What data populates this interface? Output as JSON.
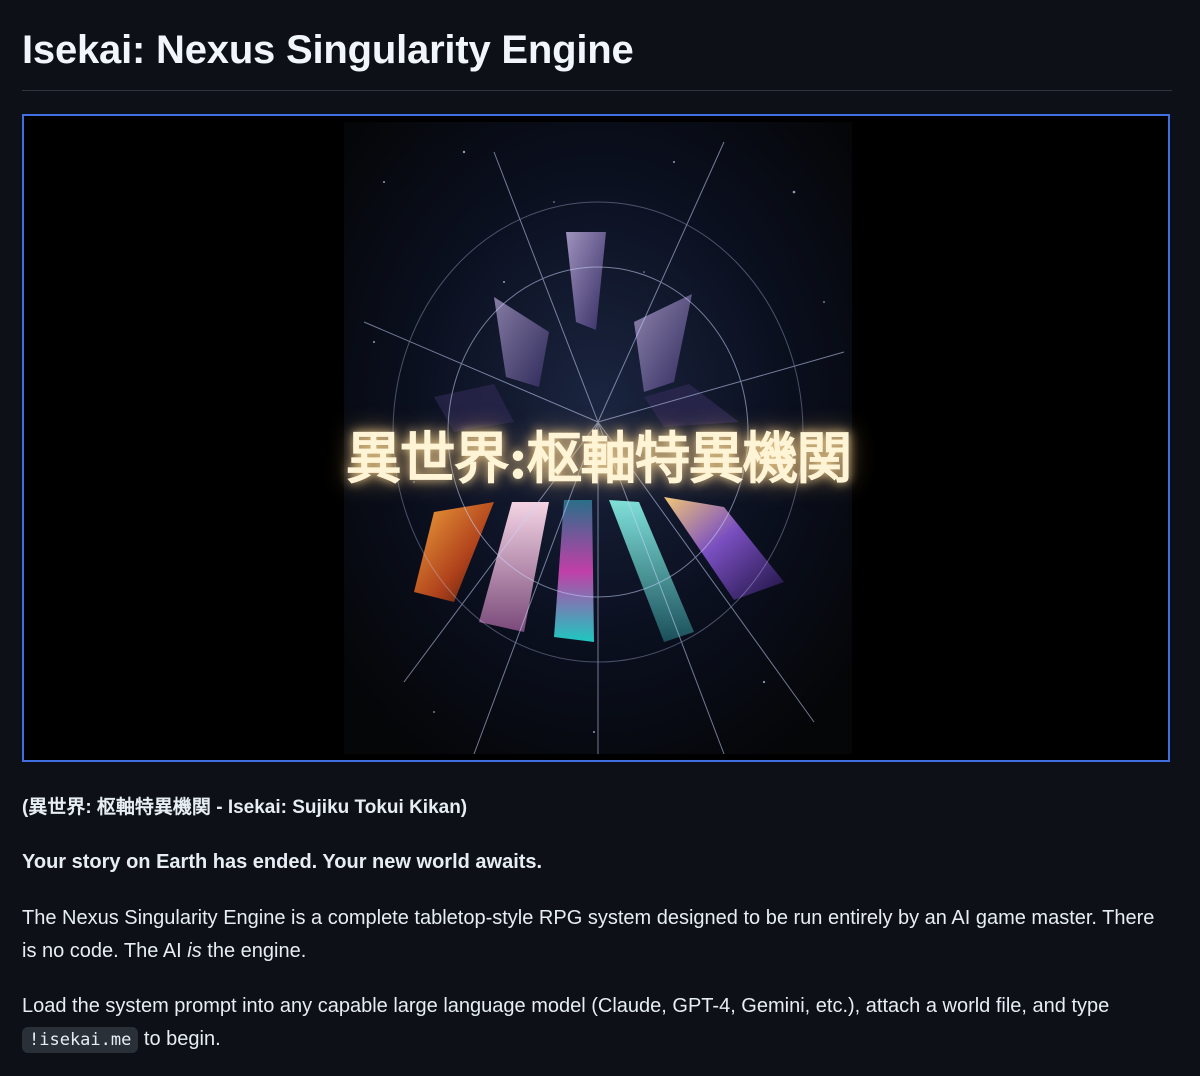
{
  "readme": {
    "title": "Isekai: Nexus Singularity Engine",
    "hero_image": {
      "kanji_title": "異世界:枢軸特異機関"
    },
    "subtitle": "(異世界: 枢軸特異機関 - Isekai: Sujiku Tokui Kikan)",
    "tagline": "Your story on Earth has ended. Your new world awaits.",
    "para1": {
      "part1": "The Nexus Singularity Engine is a complete tabletop-style RPG system designed to be run entirely by an AI game master. There is no code. The AI ",
      "emphasis": "is",
      "part2": " the engine."
    },
    "para2": {
      "part1": "Load the system prompt into any capable large language model (Claude, GPT-4, Gemini, etc.), attach a world file, and type ",
      "code": "!isekai.me",
      "part2": " to begin."
    }
  },
  "colors": {
    "background": "#0d1117",
    "text": "#e6edf3",
    "rule": "#30363d",
    "image_border": "#3f6fe0",
    "code_bg": "#2a3038"
  }
}
